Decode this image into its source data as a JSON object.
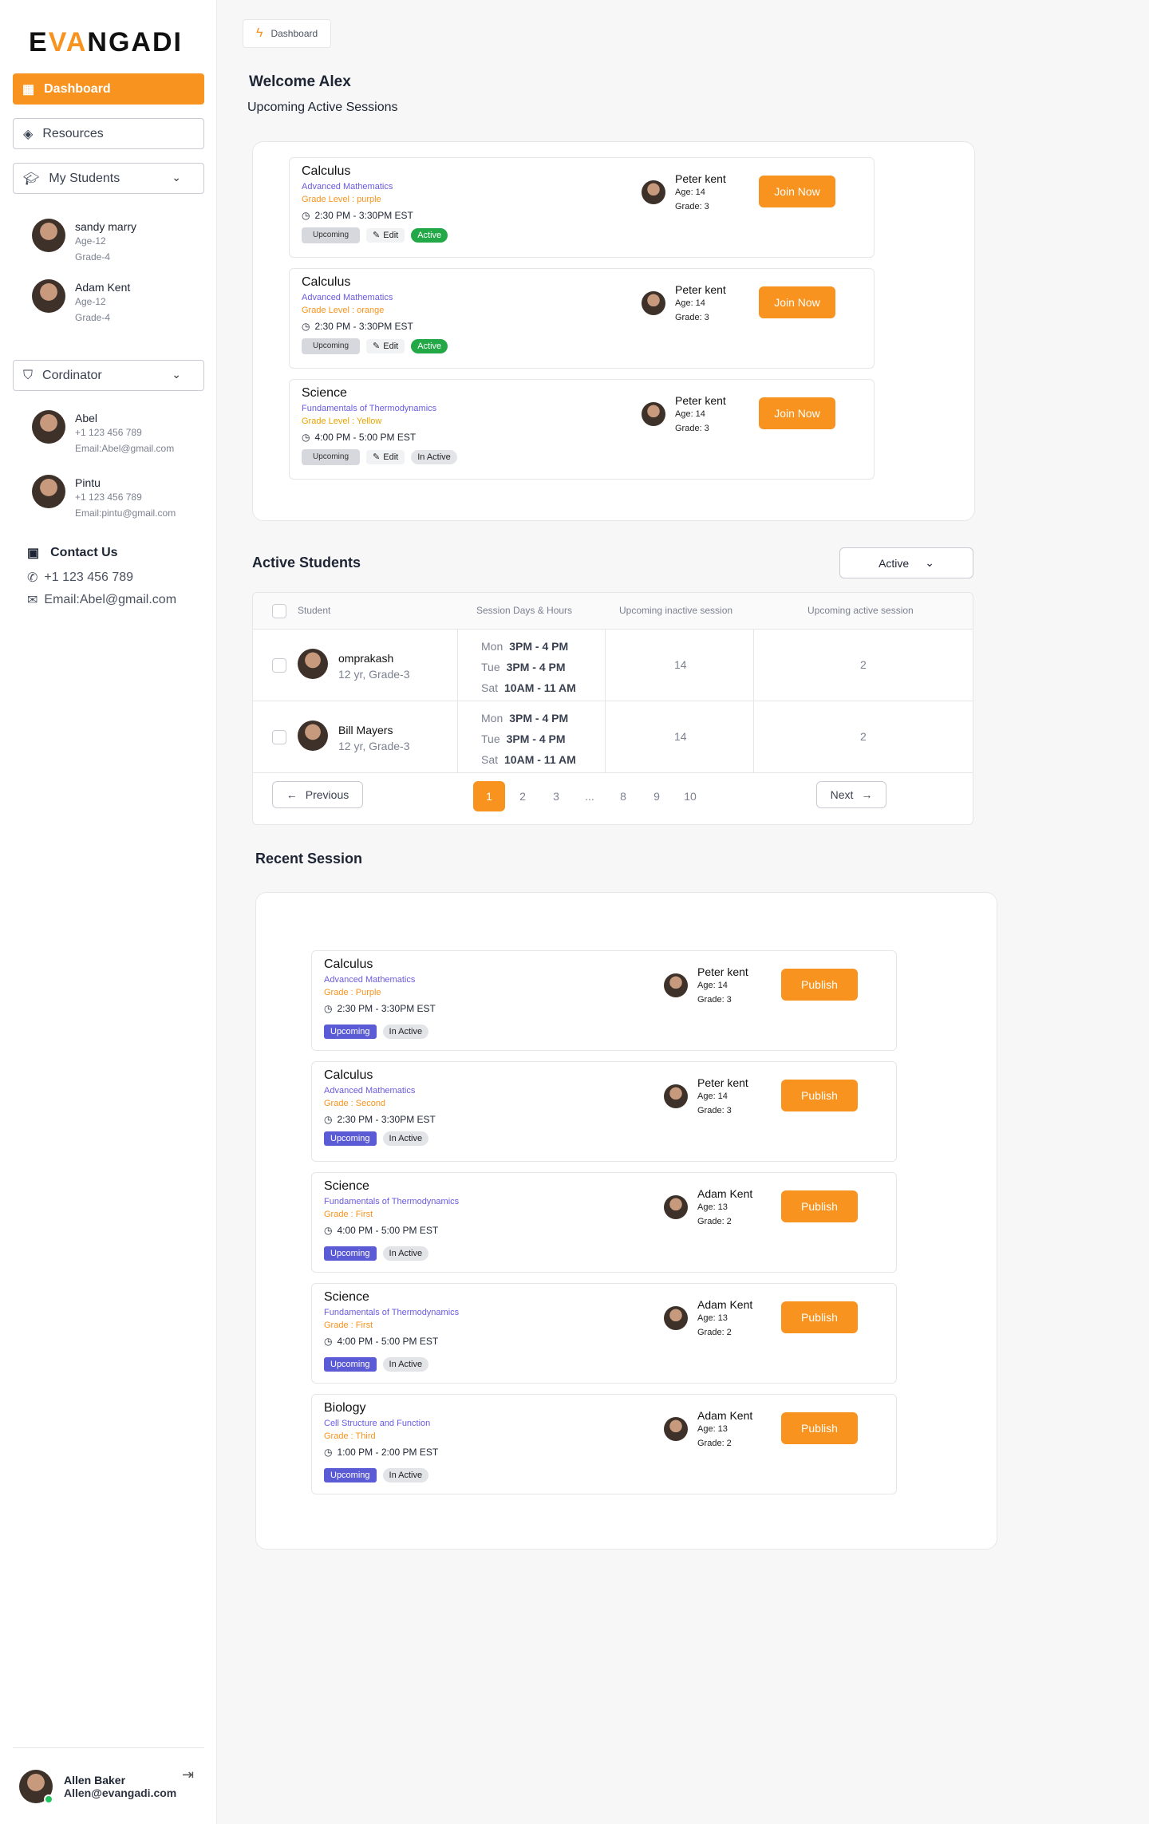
{
  "brand": {
    "logo_left": "E",
    "logo_accent": "VA",
    "logo_right": "NGADI"
  },
  "sidebar": {
    "dashboard_label": "Dashboard",
    "resources_label": "Resources",
    "my_students_label": "My Students",
    "students": [
      {
        "name": "sandy marry",
        "age": "Age-12",
        "grade": "Grade-4"
      },
      {
        "name": "Adam Kent",
        "age": "Age-12",
        "grade": "Grade-4"
      }
    ],
    "coordinator_label": "Cordinator",
    "coordinators": [
      {
        "name": "Abel",
        "phone": "+1 123 456 789",
        "email": "Email:Abel@gmail.com"
      },
      {
        "name": "Pintu",
        "phone": "+1 123 456 789",
        "email": "Email:pintu@gmail.com"
      }
    ],
    "contact_title": "Contact Us",
    "contact_phone": "+1 123 456 789",
    "contact_email": "Email:Abel@gmail.com",
    "user_name": "Allen Baker",
    "user_email": "Allen@evangadi.com"
  },
  "header": {
    "breadcrumb": "Dashboard",
    "welcome": "Welcome  Alex",
    "subheading": "Upcoming  Active Sessions"
  },
  "upcoming_sessions": [
    {
      "subject": "Calculus",
      "topic": "Advanced  Mathematics",
      "grade": "Grade Level : purple",
      "time": "2:30 PM - 3:30PM EST",
      "tag_upcoming": "Upcoming",
      "tag_edit": "Edit",
      "status": "Active",
      "learner": "Peter kent",
      "age": "Age: 14",
      "lgrade": "Grade: 3",
      "button": "Join Now"
    },
    {
      "subject": "Calculus",
      "topic": "Advanced  Mathematics",
      "grade": "Grade Level : orange",
      "time": "2:30 PM - 3:30PM EST",
      "tag_upcoming": "Upcoming",
      "tag_edit": "Edit",
      "status": "Active",
      "learner": "Peter kent",
      "age": "Age: 14",
      "lgrade": "Grade: 3",
      "button": "Join Now"
    },
    {
      "subject": "Science",
      "topic": "Fundamentals of Thermodynamics",
      "grade": "Grade Level : Yellow",
      "time": "4:00 PM - 5:00 PM EST",
      "tag_upcoming": "Upcoming",
      "tag_edit": "Edit",
      "status": "In Active",
      "learner": "Peter kent",
      "age": "Age: 14",
      "lgrade": "Grade: 3",
      "button": "Join Now"
    }
  ],
  "active_students": {
    "title": "Active Students",
    "filter_value": "Active",
    "headers": [
      "Student",
      "Session Days & Hours",
      "Upcoming inactive session",
      "Upcoming active session"
    ],
    "rows": [
      {
        "name": "omprakash",
        "meta": "12 yr, Grade-3",
        "schedule": [
          [
            "Mon",
            "3PM - 4 PM"
          ],
          [
            "Tue",
            "3PM - 4 PM"
          ],
          [
            "Sat",
            "10AM - 11 AM"
          ]
        ],
        "inactive": "14",
        "active": "2"
      },
      {
        "name": "Bill Mayers",
        "meta": "12 yr, Grade-3",
        "schedule": [
          [
            "Mon",
            "3PM - 4 PM"
          ],
          [
            "Tue",
            "3PM - 4 PM"
          ],
          [
            "Sat",
            "10AM - 11 AM"
          ]
        ],
        "inactive": "14",
        "active": "2"
      }
    ],
    "pagination": {
      "previous": "Previous",
      "next": "Next",
      "pages": [
        "1",
        "2",
        "3",
        "...",
        "8",
        "9",
        "10"
      ],
      "current": "1"
    }
  },
  "recent_sessions": {
    "title": "Recent Session",
    "items": [
      {
        "subject": "Calculus",
        "topic": "Advanced  Mathematics",
        "grade": "Grade : Purple",
        "time": "2:30 PM - 3:30PM EST",
        "tag_upcoming": "Upcoming",
        "status": "In Active",
        "learner": "Peter kent",
        "age": "Age: 14",
        "lgrade": "Grade: 3",
        "button": "Publish"
      },
      {
        "subject": "Calculus",
        "topic": "Advanced  Mathematics",
        "grade": "Grade : Second",
        "time": "2:30 PM - 3:30PM EST",
        "tag_upcoming": "Upcoming",
        "status": "In Active",
        "learner": "Peter kent",
        "age": "Age: 14",
        "lgrade": "Grade: 3",
        "button": "Publish"
      },
      {
        "subject": "Science",
        "topic": "Fundamentals of Thermodynamics",
        "grade": "Grade : First",
        "time": "4:00 PM - 5:00 PM EST",
        "tag_upcoming": "Upcoming",
        "status": "In Active",
        "learner": "Adam Kent",
        "age": "Age: 13",
        "lgrade": "Grade: 2",
        "button": "Publish"
      },
      {
        "subject": "Science",
        "topic": "Fundamentals of Thermodynamics",
        "grade": "Grade : First",
        "time": "4:00 PM - 5:00 PM EST",
        "tag_upcoming": "Upcoming",
        "status": "In Active",
        "learner": "Adam Kent",
        "age": "Age: 13",
        "lgrade": "Grade: 2",
        "button": "Publish"
      },
      {
        "subject": "Biology",
        "topic": "Cell Structure and Function",
        "grade": "Grade : Third",
        "time": "1:00 PM - 2:00 PM EST",
        "tag_upcoming": "Upcoming",
        "status": "In Active",
        "learner": "Adam Kent",
        "age": "Age: 13",
        "lgrade": "Grade: 2",
        "button": "Publish"
      }
    ]
  },
  "colors": {
    "accent": "#f7931e",
    "active_tag": "#23a847",
    "upcoming_tag": "#5b5bd6",
    "topic_text": "#6a5ae0"
  },
  "icons": [
    "grid-icon",
    "layers-icon",
    "graduation-cap-icon",
    "chevron-down-icon",
    "shield-user-icon",
    "contact-card-icon",
    "phone-icon",
    "mail-icon",
    "logout-icon",
    "bolt-icon",
    "clock-icon",
    "pencil-icon",
    "arrow-left-icon",
    "arrow-right-icon"
  ]
}
